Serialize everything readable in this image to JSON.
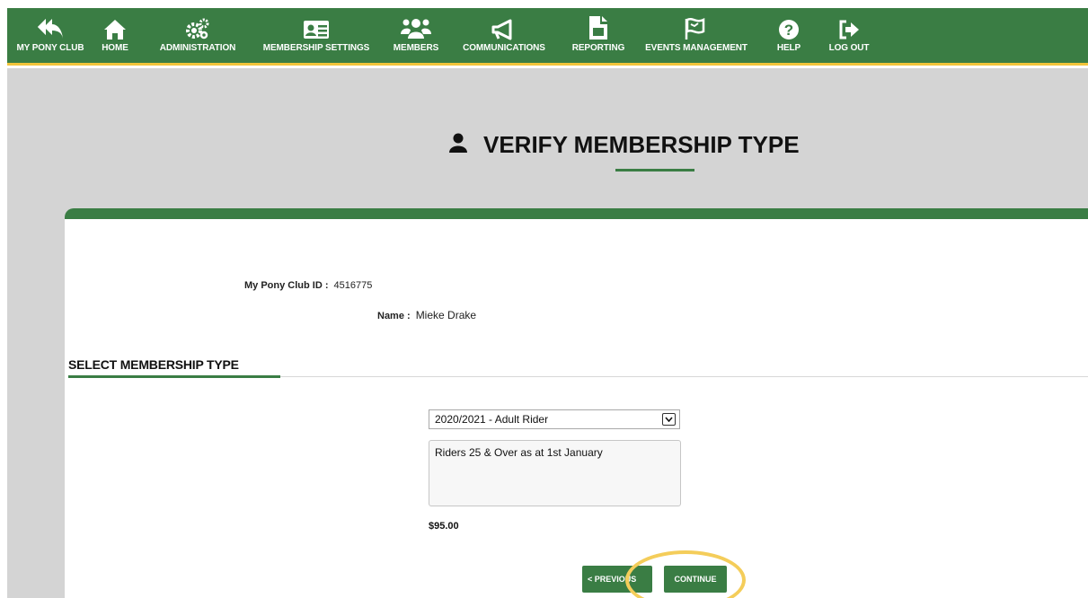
{
  "nav": {
    "items": [
      {
        "label": "MY PONY CLUB",
        "icon": "reply-all-icon"
      },
      {
        "label": "HOME",
        "icon": "home-icon"
      },
      {
        "label": "ADMINISTRATION",
        "icon": "gears-icon"
      },
      {
        "label": "MEMBERSHIP SETTINGS",
        "icon": "id-card-icon"
      },
      {
        "label": "MEMBERS",
        "icon": "users-icon"
      },
      {
        "label": "COMMUNICATIONS",
        "icon": "megaphone-icon"
      },
      {
        "label": "REPORTING",
        "icon": "report-icon"
      },
      {
        "label": "EVENTS MANAGEMENT",
        "icon": "flag-icon"
      },
      {
        "label": "HELP",
        "icon": "question-circle-icon"
      },
      {
        "label": "LOG OUT",
        "icon": "sign-out-icon"
      }
    ]
  },
  "page": {
    "title": "VERIFY MEMBERSHIP TYPE",
    "title_icon": "user-icon"
  },
  "member": {
    "id_label": "My Pony Club ID :",
    "id_value": "4516775",
    "name_label": "Name :",
    "name_value": "Mieke Drake"
  },
  "section": {
    "heading": "SELECT MEMBERSHIP TYPE"
  },
  "membership": {
    "selected": "2020/2021 - Adult Rider",
    "description": "Riders 25 & Over as at 1st January",
    "price": "$95.00"
  },
  "buttons": {
    "previous": "< PREVIOUS",
    "continue": "CONTINUE"
  },
  "colors": {
    "brand_green": "#3a7d44",
    "accent_yellow": "#f2c43a",
    "highlight": "#f4cd5a",
    "page_gray": "#d4d4d4"
  }
}
